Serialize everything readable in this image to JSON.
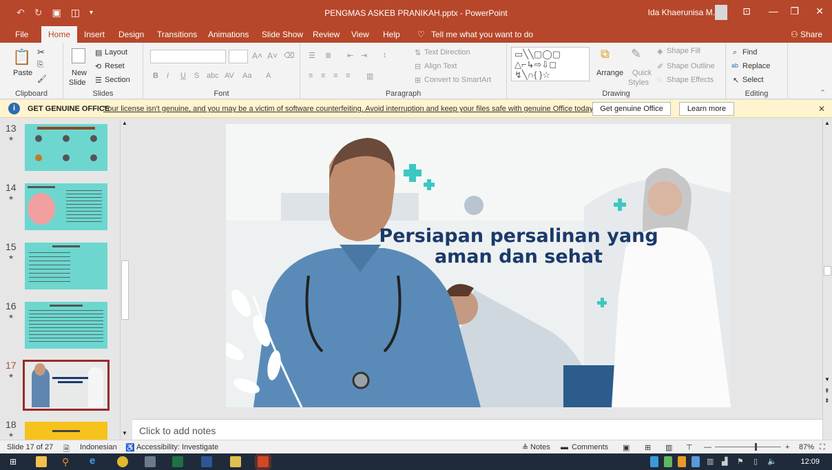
{
  "window": {
    "title": "PENGMAS ASKEB PRANIKAH.pptx - PowerPoint",
    "user": "Ida Khaerunisa M."
  },
  "tabs": [
    "File",
    "Home",
    "Insert",
    "Design",
    "Transitions",
    "Animations",
    "Slide Show",
    "Review",
    "View",
    "Help"
  ],
  "tell_me": "Tell me what you want to do",
  "share": "Share",
  "ribbon": {
    "clipboard": {
      "paste": "Paste",
      "label": "Clipboard"
    },
    "slides": {
      "new_slide": "New",
      "new_slide2": "Slide",
      "layout": "Layout",
      "reset": "Reset",
      "section": "Section",
      "label": "Slides"
    },
    "font": {
      "label": "Font"
    },
    "paragraph": {
      "text_direction": "Text Direction",
      "align_text": "Align Text",
      "smartart": "Convert to SmartArt",
      "label": "Paragraph"
    },
    "drawing": {
      "arrange": "Arrange",
      "quick": "Quick",
      "styles": "Styles",
      "shape_fill": "Shape Fill",
      "shape_outline": "Shape Outline",
      "shape_effects": "Shape Effects",
      "label": "Drawing"
    },
    "editing": {
      "find": "Find",
      "replace": "Replace",
      "select": "Select",
      "label": "Editing"
    }
  },
  "infobar": {
    "title": "GET GENUINE OFFICE",
    "message": "Your license isn't genuine, and you may be a victim of software counterfeiting. Avoid interruption and keep your files safe with genuine Office today.",
    "btn_genuine": "Get genuine Office",
    "btn_learn": "Learn more"
  },
  "thumbnails": [
    {
      "num": "13"
    },
    {
      "num": "14"
    },
    {
      "num": "15"
    },
    {
      "num": "16"
    },
    {
      "num": "17"
    },
    {
      "num": "18"
    }
  ],
  "slide": {
    "title": "Persiapan persalinan yang aman dan sehat"
  },
  "notes_placeholder": "Click to add notes",
  "status": {
    "slide": "Slide 17 of 27",
    "language": "Indonesian",
    "accessibility": "Accessibility: Investigate",
    "notes": "Notes",
    "comments": "Comments",
    "zoom": "87%"
  },
  "clock": "12:09",
  "colors": {
    "accent": "#b7472a",
    "title_blue": "#1a3a6a",
    "teal": "#3cc8c0"
  }
}
